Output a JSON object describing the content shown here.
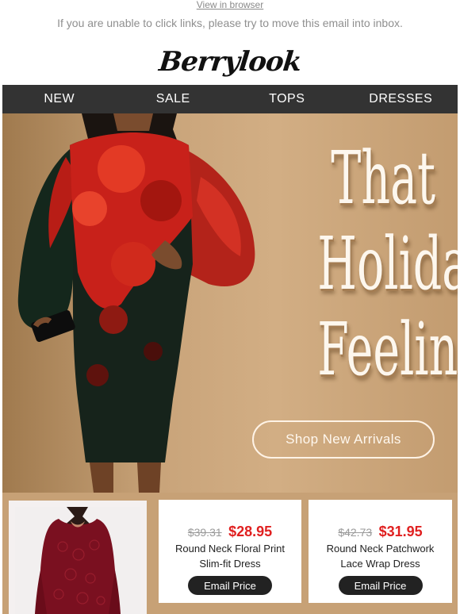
{
  "preheader": {
    "view_link": "View in browser",
    "note": "If you are unable to click links, please try to move this email into inbox."
  },
  "brand": {
    "logo_text": "Berrylook"
  },
  "nav": {
    "items": [
      "NEW",
      "SALE",
      "TOPS",
      "DRESSES"
    ]
  },
  "hero": {
    "headline": [
      "That",
      "Holiday",
      "Feeling"
    ],
    "cta_label": "Shop New Arrivals",
    "colors": {
      "background": "#c9a47a",
      "dress_red": "#c8211a",
      "dress_green": "#16231b"
    }
  },
  "products": [
    {
      "image": "burgundy-lace-dress"
    },
    {
      "old_price": "$39.31",
      "new_price": "$28.95",
      "name_line1": "Round Neck Floral Print",
      "name_line2": "Slim-fit Dress",
      "button": "Email Price"
    },
    {
      "old_price": "$42.73",
      "new_price": "$31.95",
      "name_line1": "Round Neck Patchwork",
      "name_line2": "Lace Wrap Dress",
      "button": "Email Price"
    }
  ],
  "colors": {
    "nav_bg": "#333333",
    "sale_price": "#e02020",
    "button_bg": "#222222"
  }
}
